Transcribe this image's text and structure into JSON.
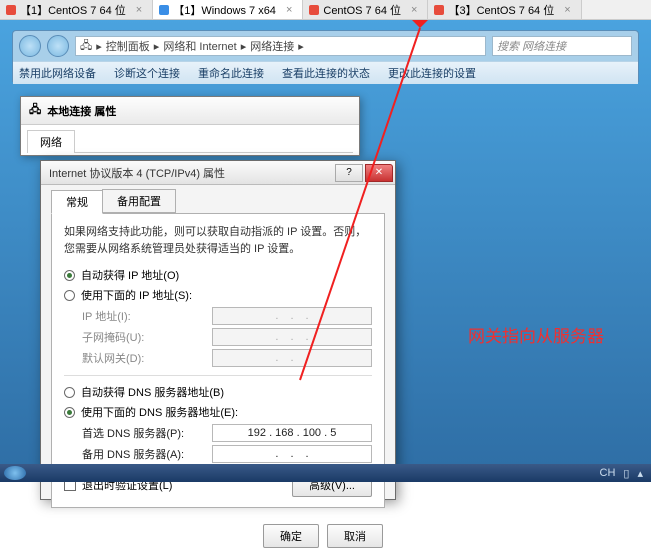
{
  "vm_tabs": [
    {
      "label": "【1】CentOS 7 64 位",
      "active": false,
      "icon": "linux"
    },
    {
      "label": "【1】Windows 7 x64",
      "active": true,
      "icon": "win"
    },
    {
      "label": "CentOS 7 64 位",
      "active": false,
      "icon": "linux"
    },
    {
      "label": "【3】CentOS 7 64 位",
      "active": false,
      "icon": "linux"
    }
  ],
  "breadcrumb": {
    "a": "控制面板",
    "b": "网络和 Internet",
    "c": "网络连接"
  },
  "search_placeholder": "搜索 网络连接",
  "toolbar": {
    "a": "禁用此网络设备",
    "b": "诊断这个连接",
    "c": "重命名此连接",
    "d": "查看此连接的状态",
    "e": "更改此连接的设置"
  },
  "win_a": {
    "title": "本地连接 属性",
    "tab": "网络"
  },
  "ipv4": {
    "title": "Internet 协议版本 4 (TCP/IPv4) 属性",
    "tab1": "常规",
    "tab2": "备用配置",
    "desc": "如果网络支持此功能，则可以获取自动指派的 IP 设置。否则，您需要从网络系统管理员处获得适当的 IP 设置。",
    "r1": "自动获得 IP 地址(O)",
    "r2": "使用下面的 IP 地址(S):",
    "f_ip": "IP 地址(I):",
    "f_mask": "子网掩码(U):",
    "f_gw": "默认网关(D):",
    "r3": "自动获得 DNS 服务器地址(B)",
    "r4": "使用下面的 DNS 服务器地址(E):",
    "f_dns1": "首选 DNS 服务器(P):",
    "f_dns2": "备用 DNS 服务器(A):",
    "dns1_value": "192 . 168 . 100 .  5",
    "chk": "退出时验证设置(L)",
    "adv": "高级(V)...",
    "ok": "确定",
    "cancel": "取消"
  },
  "annotation": "网关指向从服务器",
  "tray": {
    "ime": "CH"
  }
}
